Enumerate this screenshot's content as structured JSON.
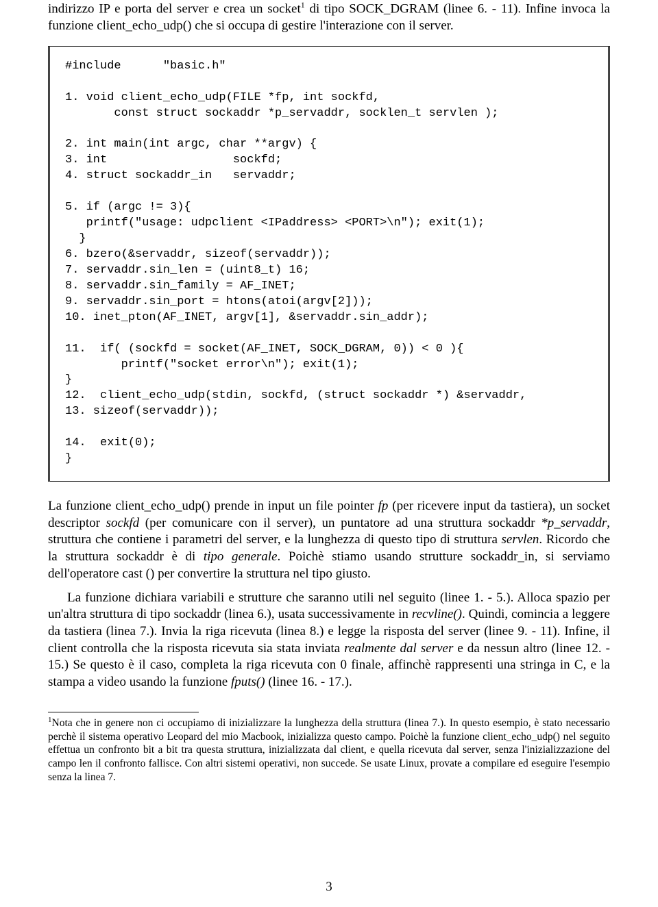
{
  "intro": {
    "part1": "indirizzo IP e porta del server e crea un socket",
    "sup1": "1",
    "part2": " di tipo SOCK_DGRAM (linee 6. - 11). Infine invoca la funzione client_echo_udp() che si occupa di gestire l'interazione con il server."
  },
  "code": {
    "lines": [
      "#include      \"basic.h\"",
      "",
      "1. void client_echo_udp(FILE *fp, int sockfd,",
      "       const struct sockaddr *p_servaddr, socklen_t servlen );",
      "",
      "2. int main(int argc, char **argv) {",
      "3. int                  sockfd;",
      "4. struct sockaddr_in   servaddr;",
      "",
      "5. if (argc != 3){",
      "   printf(\"usage: udpclient <IPaddress> <PORT>\\n\"); exit(1);",
      "  }",
      "6. bzero(&servaddr, sizeof(servaddr));",
      "7. servaddr.sin_len = (uint8_t) 16;",
      "8. servaddr.sin_family = AF_INET;",
      "9. servaddr.sin_port = htons(atoi(argv[2]));",
      "10. inet_pton(AF_INET, argv[1], &servaddr.sin_addr);",
      "",
      "11.  if( (sockfd = socket(AF_INET, SOCK_DGRAM, 0)) < 0 ){",
      "        printf(\"socket error\\n\"); exit(1);",
      "}",
      "12.  client_echo_udp(stdin, sockfd, (struct sockaddr *) &servaddr,",
      "13. sizeof(servaddr));",
      "",
      "14.  exit(0);",
      "}"
    ]
  },
  "para2": {
    "s1": "La funzione client_echo_udp() prende in input un file pointer ",
    "i1": "fp",
    "s2": " (per ricevere input da tastiera), un socket descriptor ",
    "i2": "sockfd",
    "s3": " (per comunicare con il server), un puntatore ad una struttura sockaddr ",
    "i3": "*p_servaddr",
    "s4": ", struttura che contiene i parametri del server, e la lunghezza di questo tipo di struttura ",
    "i4": "servlen",
    "s5": ". Ricordo che la struttura sockaddr è di ",
    "i5": "tipo generale",
    "s6": ". Poichè stiamo usando strutture sockaddr_in, si serviamo dell'operatore cast () per convertire la struttura nel tipo giusto."
  },
  "para3": {
    "s1": "La funzione dichiara variabili e strutture che saranno utili nel seguito (linee 1. - 5.). Alloca spazio per un'altra struttura di tipo sockaddr (linea 6.), usata successivamente in ",
    "i1": "recvline()",
    "s2": ". Quindi, comincia a leggere da tastiera (linea 7.). Invia la riga ricevuta (linea 8.) e legge la risposta del server (linee 9. - 11). Infine, il client controlla che la risposta ricevuta sia stata inviata ",
    "i2": "realmente dal server",
    "s3": " e da nessun altro (linee 12. - 15.) Se questo è il caso, completa la riga ricevuta con 0 finale, affinchè rappresenti una stringa in C, e la stampa a video usando la funzione ",
    "i3": "fputs()",
    "s4": " (linee 16. - 17.)."
  },
  "footnote": {
    "sup": "1",
    "text": "Nota che in genere non ci occupiamo di inizializzare la lunghezza della struttura (linea 7.). In questo esempio, è stato necessario perchè il sistema operativo Leopard del mio Macbook, inizializza questo campo. Poichè la funzione client_echo_udp() nel seguito effettua un confronto bit a bit tra questa struttura, inizializzata dal client, e quella ricevuta dal server, senza l'inizializzazione del campo len il confronto fallisce. Con altri sistemi operativi, non succede. Se usate Linux, provate a compilare ed eseguire l'esempio senza la linea 7."
  },
  "pagenum": "3"
}
